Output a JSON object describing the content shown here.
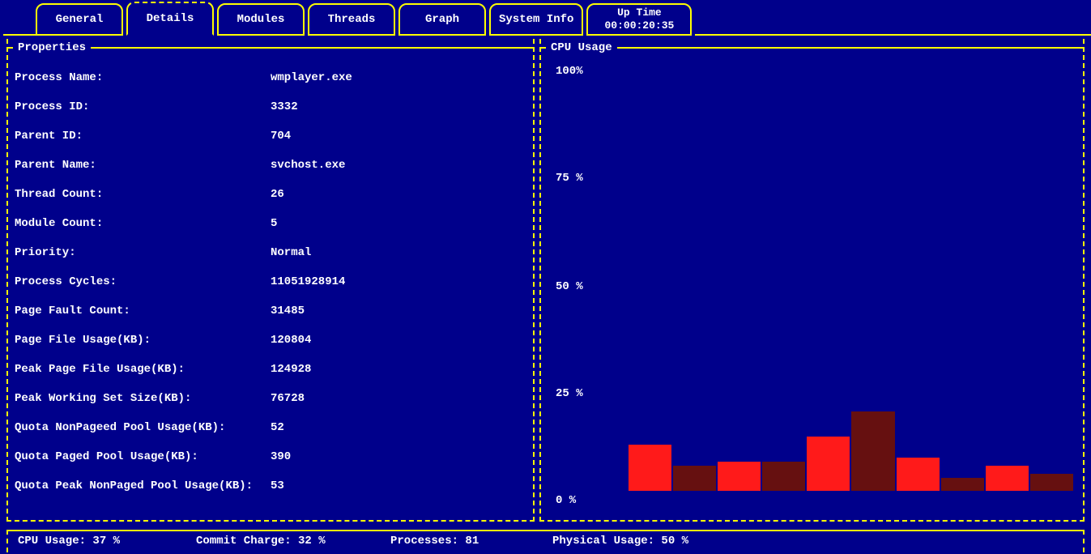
{
  "tabs": {
    "general": "General",
    "details": "Details",
    "modules": "Modules",
    "threads": "Threads",
    "graph": "Graph",
    "system_info": "System Info",
    "uptime_label": "Up Time",
    "uptime_value": "00:00:20:35"
  },
  "panels": {
    "properties_title": "Properties",
    "cpu_title": "CPU Usage"
  },
  "properties": [
    {
      "label": "Process Name:",
      "value": "wmplayer.exe"
    },
    {
      "label": "Process ID:",
      "value": "3332"
    },
    {
      "label": "Parent ID:",
      "value": "704"
    },
    {
      "label": "Parent Name:",
      "value": "svchost.exe"
    },
    {
      "label": "Thread Count:",
      "value": "26"
    },
    {
      "label": "Module Count:",
      "value": "5"
    },
    {
      "label": "Priority:",
      "value": "Normal"
    },
    {
      "label": "Process Cycles:",
      "value": "11051928914"
    },
    {
      "label": "Page Fault Count:",
      "value": "31485"
    },
    {
      "label": "Page File Usage(KB):",
      "value": "120804"
    },
    {
      "label": "Peak Page File Usage(KB):",
      "value": "124928"
    },
    {
      "label": "Peak Working Set Size(KB):",
      "value": "76728"
    },
    {
      "label": "Quota NonPageed Pool Usage(KB):",
      "value": "52"
    },
    {
      "label": "Quota Paged Pool Usage(KB):",
      "value": "390"
    },
    {
      "label": "Quota Peak NonPaged Pool Usage(KB):",
      "value": "53"
    }
  ],
  "chart_data": {
    "type": "bar",
    "title": "CPU Usage",
    "ylabel": "%",
    "ylim": [
      0,
      100
    ],
    "y_ticks": [
      "100%",
      "75 %",
      "50 %",
      "25 %",
      "0  %"
    ],
    "series": [
      {
        "name": "cpu",
        "values": [
          11,
          6,
          7,
          7,
          13,
          19,
          8,
          3,
          6,
          4
        ]
      }
    ],
    "bar_shade": [
      "bright",
      "dark",
      "bright",
      "dark",
      "bright",
      "dark",
      "bright",
      "dark",
      "bright",
      "dark"
    ]
  },
  "status": {
    "cpu": "CPU Usage: 37 %",
    "commit": "Commit Charge: 32 %",
    "processes": "Processes: 81",
    "physical": "Physical Usage: 50 %"
  }
}
